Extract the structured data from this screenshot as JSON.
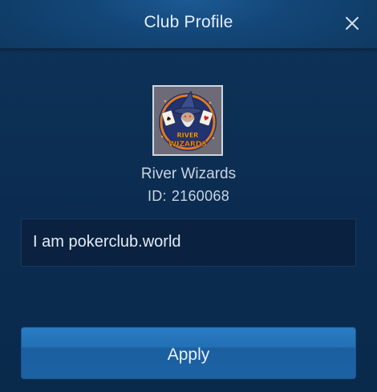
{
  "dialog": {
    "title": "Club Profile",
    "close_icon": "close-icon"
  },
  "club": {
    "logo_icon": "river-wizards-logo",
    "logo_text_top": "RIVER",
    "logo_text_bottom": "WIZARDS",
    "name": "River Wizards",
    "id_label": "ID:",
    "id_value": "2160068"
  },
  "description": {
    "value": "I am pokerclub.world"
  },
  "actions": {
    "apply_label": "Apply"
  },
  "colors": {
    "background": "#0b2c50",
    "header": "#134677",
    "button": "#2370b4",
    "text": "#e6eef8"
  }
}
